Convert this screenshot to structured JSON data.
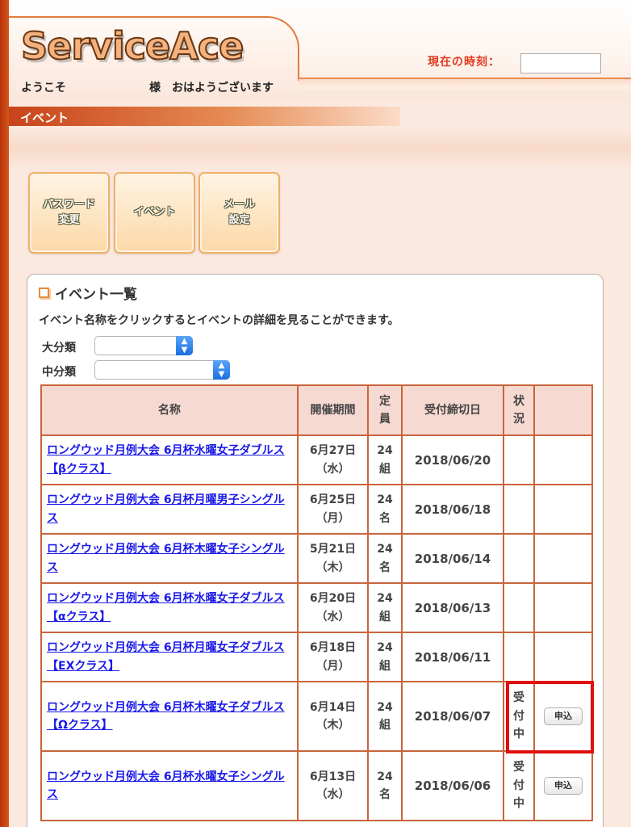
{
  "header": {
    "logo": "ServiceAce",
    "time_label": "現在の時刻：",
    "time_value": "",
    "welcome_prefix": "ようこそ",
    "welcome_suffix": "様　おはようございます"
  },
  "section": {
    "title": "イベント"
  },
  "nav": [
    {
      "label": "パスワード\n変更"
    },
    {
      "label": "イベント"
    },
    {
      "label": "メール\n設定"
    }
  ],
  "panel": {
    "title": "イベント一覧",
    "description": "イベント名称をクリックするとイベントの詳細を見ることができます。",
    "filter_major_label": "大分類",
    "filter_minor_label": "中分類",
    "filter_major_value": "",
    "filter_minor_value": ""
  },
  "table": {
    "headers": {
      "name": "名称",
      "period": "開催期間",
      "capacity": "定\n員",
      "deadline": "受付締切日",
      "status": "状\n況",
      "action": ""
    },
    "rows": [
      {
        "name": "ロングウッド月例大会 6月杯水曜女子ダブルス【βクラス】",
        "period": "6月27日\n（水）",
        "capacity": "24\n組",
        "deadline": "2018/06/20",
        "status": "",
        "action": ""
      },
      {
        "name": "ロングウッド月例大会 6月杯月曜男子シングルス",
        "period": "6月25日\n（月）",
        "capacity": "24\n名",
        "deadline": "2018/06/18",
        "status": "",
        "action": ""
      },
      {
        "name": "ロングウッド月例大会 6月杯木曜女子シングルス",
        "period": "5月21日\n（木）",
        "capacity": "24\n名",
        "deadline": "2018/06/14",
        "status": "",
        "action": ""
      },
      {
        "name": "ロングウッド月例大会 6月杯水曜女子ダブルス【αクラス】",
        "period": "6月20日\n（水）",
        "capacity": "24\n組",
        "deadline": "2018/06/13",
        "status": "",
        "action": ""
      },
      {
        "name": "ロングウッド月例大会 6月杯月曜女子ダブルス【EXクラス】",
        "period": "6月18日\n（月）",
        "capacity": "24\n組",
        "deadline": "2018/06/11",
        "status": "",
        "action": ""
      },
      {
        "name": "ロングウッド月例大会 6月杯木曜女子ダブルス【Ωクラス】",
        "period": "6月14日\n（木）",
        "capacity": "24\n組",
        "deadline": "2018/06/07",
        "status": "受\n付\n中",
        "action": "申込"
      },
      {
        "name": "ロングウッド月例大会 6月杯水曜女子シングルス",
        "period": "6月13日\n（水）",
        "capacity": "24\n名",
        "deadline": "2018/06/06",
        "status": "受\n付\n中",
        "action": "申込"
      }
    ]
  },
  "colors": {
    "accent": "#c8653c",
    "link": "#1a1ae8",
    "highlight": "#e01010",
    "time_label": "#e23a1c"
  }
}
